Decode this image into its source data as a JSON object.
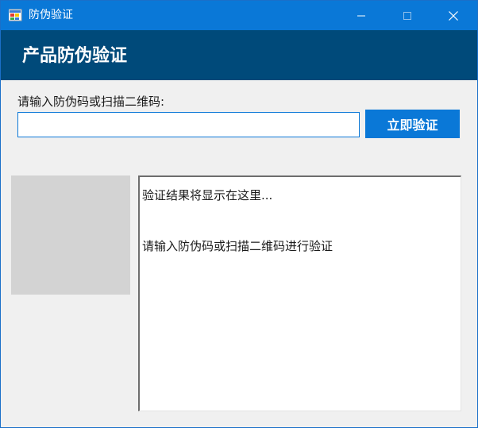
{
  "window": {
    "title": "防伪验证",
    "controls": {
      "minimize_icon": "minimize-icon",
      "maximize_icon": "maximize-icon",
      "close_icon": "close-icon"
    }
  },
  "banner": {
    "title": "产品防伪验证"
  },
  "form": {
    "prompt_label": "请输入防伪码或扫描二维码:",
    "code_value": "",
    "verify_label": "立即验证"
  },
  "result": {
    "line1": "验证结果将显示在这里...",
    "line2": "请输入防伪码或扫描二维码进行验证"
  },
  "colors": {
    "titlebar": "#0a78d7",
    "banner": "#004a7a",
    "accent": "#0a78d7",
    "background": "#f0f0f0",
    "qr_placeholder": "#d3d3d3"
  }
}
